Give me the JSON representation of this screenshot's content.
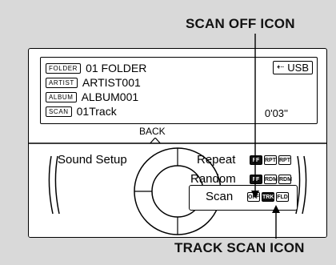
{
  "callouts": {
    "top": "SCAN OFF ICON",
    "bottom": "TRACK SCAN ICON"
  },
  "display": {
    "rows": [
      {
        "tag": "FOLDER",
        "text": "01 FOLDER"
      },
      {
        "tag": "ARTIST",
        "text": "ARTIST001"
      },
      {
        "tag": "ALBUM",
        "text": "ALBUM001"
      },
      {
        "tag": "SCAN",
        "text": "01Track"
      }
    ],
    "source": "USB",
    "source_icon": "usb-icon",
    "time": "0'03''"
  },
  "back_label": "BACK",
  "menu": {
    "sound_setup": "Sound Setup",
    "repeat": "Repeat",
    "random": "Random",
    "scan": "Scan",
    "repeat_icons": [
      "FF",
      "RPT",
      "RPT"
    ],
    "random_icons": [
      "FF",
      "RDM",
      "RDM"
    ],
    "scan_icons": [
      "OFF",
      "TRK",
      "FLD"
    ]
  }
}
